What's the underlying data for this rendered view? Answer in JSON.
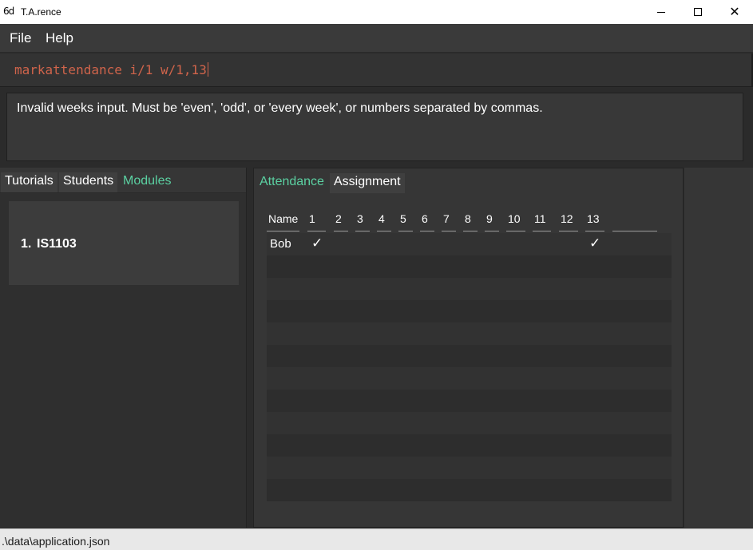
{
  "window": {
    "icon": "6d",
    "title": "T.A.rence",
    "minimize_icon": "minimize-icon",
    "maximize_icon": "maximize-icon",
    "close_icon": "close-icon",
    "close_glyph": "✕"
  },
  "menu": {
    "file": "File",
    "help": "Help"
  },
  "command": {
    "value": "markattendance i/1 w/1,13",
    "text_color": "#d0644b"
  },
  "result": {
    "message": "Invalid weeks input. Must be 'even', 'odd', or 'every week', or numbers separated by commas."
  },
  "left_tabs": {
    "tutorials": "Tutorials",
    "students": "Students",
    "modules": "Modules",
    "active": "Modules",
    "accent": "#5bd1a2"
  },
  "modules": {
    "items": [
      {
        "index": "1.",
        "code": "IS1103"
      }
    ]
  },
  "right_tabs": {
    "attendance": "Attendance",
    "assignment": "Assignment",
    "active": "Attendance"
  },
  "attendance": {
    "headers": [
      "Name",
      "1",
      "2",
      "3",
      "4",
      "5",
      "6",
      "7",
      "8",
      "9",
      "10",
      "11",
      "12",
      "13",
      ""
    ],
    "rows": [
      {
        "name": "Bob",
        "week1": "✓",
        "week13": "✓"
      }
    ]
  },
  "status": {
    "path": ".\\data\\application.json"
  }
}
